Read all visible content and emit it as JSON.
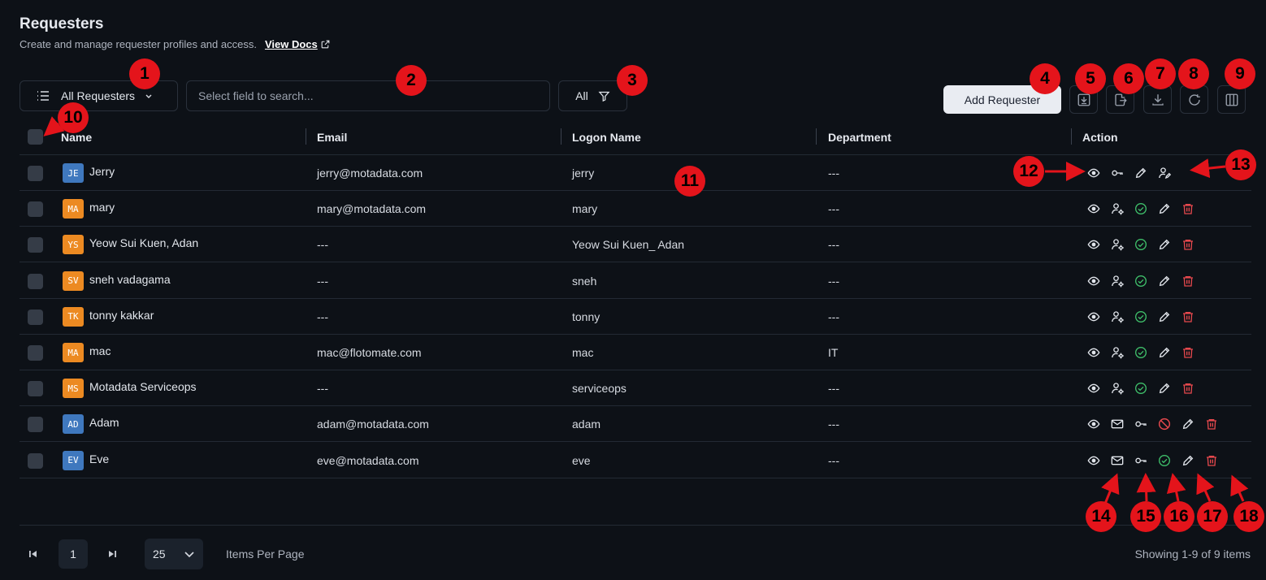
{
  "header": {
    "title": "Requesters",
    "subtitle": "Create and manage requester profiles and access.",
    "docs_link": "View Docs"
  },
  "toolbar": {
    "view_label": "All Requesters",
    "search_placeholder": "Select field to search...",
    "filter_label": "All",
    "add_button": "Add Requester",
    "tool_icons": [
      "import-icon",
      "export-icon",
      "download-icon",
      "refresh-icon",
      "columns-icon"
    ]
  },
  "table": {
    "columns": [
      "Name",
      "Email",
      "Logon Name",
      "Department",
      "Action"
    ],
    "rows": [
      {
        "initials": "JE",
        "avatar_color": "#3f78be",
        "name": "Jerry",
        "email": "jerry@motadata.com",
        "logon": "jerry",
        "department": "---",
        "actions": [
          "eye-icon",
          "key-icon",
          "pencil-icon",
          "user-edit-icon"
        ]
      },
      {
        "initials": "MA",
        "avatar_color": "#ec8a22",
        "name": "mary",
        "email": "mary@motadata.com",
        "logon": "mary",
        "department": "---",
        "actions": [
          "eye-icon",
          "user-settings-icon",
          "check-circle-icon",
          "pencil-icon",
          "trash-icon"
        ]
      },
      {
        "initials": "YS",
        "avatar_color": "#ec8a22",
        "name": "Yeow Sui Kuen, Adan",
        "email": "---",
        "logon": "Yeow Sui Kuen_ Adan",
        "department": "---",
        "actions": [
          "eye-icon",
          "user-settings-icon",
          "check-circle-icon",
          "pencil-icon",
          "trash-icon"
        ]
      },
      {
        "initials": "SV",
        "avatar_color": "#ec8a22",
        "name": "sneh vadagama",
        "email": "---",
        "logon": "sneh",
        "department": "---",
        "actions": [
          "eye-icon",
          "user-settings-icon",
          "check-circle-icon",
          "pencil-icon",
          "trash-icon"
        ]
      },
      {
        "initials": "TK",
        "avatar_color": "#ec8a22",
        "name": "tonny kakkar",
        "email": "---",
        "logon": "tonny",
        "department": "---",
        "actions": [
          "eye-icon",
          "user-settings-icon",
          "check-circle-icon",
          "pencil-icon",
          "trash-icon"
        ]
      },
      {
        "initials": "MA",
        "avatar_color": "#ec8a22",
        "name": "mac",
        "email": "mac@flotomate.com",
        "logon": "mac",
        "department": "IT",
        "actions": [
          "eye-icon",
          "user-settings-icon",
          "check-circle-icon",
          "pencil-icon",
          "trash-icon"
        ]
      },
      {
        "initials": "MS",
        "avatar_color": "#ec8a22",
        "name": "Motadata Serviceops",
        "email": "---",
        "logon": "serviceops",
        "department": "---",
        "actions": [
          "eye-icon",
          "user-settings-icon",
          "check-circle-icon",
          "pencil-icon",
          "trash-icon"
        ]
      },
      {
        "initials": "AD",
        "avatar_color": "#3f78be",
        "name": "Adam",
        "email": "adam@motadata.com",
        "logon": "adam",
        "department": "---",
        "actions": [
          "eye-icon",
          "mail-icon",
          "key-icon",
          "block-icon",
          "pencil-icon",
          "trash-icon"
        ]
      },
      {
        "initials": "EV",
        "avatar_color": "#3f78be",
        "name": "Eve",
        "email": "eve@motadata.com",
        "logon": "eve",
        "department": "---",
        "actions": [
          "eye-icon",
          "mail-icon",
          "key-icon",
          "check-circle-icon",
          "pencil-icon",
          "trash-icon"
        ]
      }
    ]
  },
  "pagination": {
    "current_page": "1",
    "page_size": "25",
    "items_per_page_label": "Items Per Page",
    "showing": "Showing 1-9 of 9 items"
  },
  "callouts": [
    "1",
    "2",
    "3",
    "4",
    "5",
    "6",
    "7",
    "8",
    "9",
    "10",
    "11",
    "12",
    "13",
    "14",
    "15",
    "16",
    "17",
    "18"
  ],
  "colors": {
    "background": "#0d1117",
    "callout": "#e4141b",
    "success": "#3fbf6a",
    "danger": "#e5484d"
  }
}
